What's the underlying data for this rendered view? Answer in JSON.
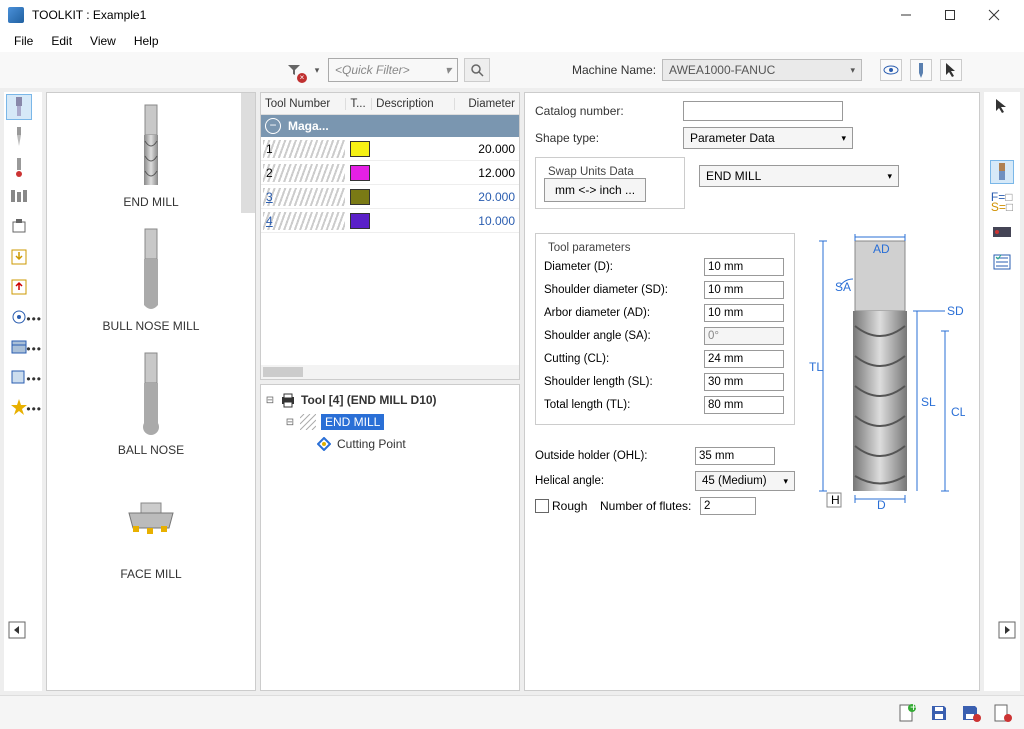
{
  "window": {
    "title": "TOOLKIT : Example1"
  },
  "menu": [
    "File",
    "Edit",
    "View",
    "Help"
  ],
  "toolbar": {
    "quick_filter_placeholder": "<Quick Filter>",
    "machine_name_label": "Machine Name:",
    "machine_name_value": "AWEA1000-FANUC"
  },
  "tool_types": [
    {
      "name": "END MILL"
    },
    {
      "name": "BULL NOSE MILL"
    },
    {
      "name": "BALL NOSE"
    },
    {
      "name": "FACE MILL"
    }
  ],
  "table": {
    "cols": [
      "Tool Number",
      "T...",
      "Description",
      "Diameter"
    ],
    "magazine_label": "Maga...",
    "rows": [
      {
        "num": "1",
        "color": "#f6f215",
        "diameter": "20.000",
        "link": false,
        "blue": false
      },
      {
        "num": "2",
        "color": "#e520e5",
        "diameter": "12.000",
        "link": false,
        "blue": false
      },
      {
        "num": "3",
        "color": "#7a7a15",
        "diameter": "20.000",
        "link": true,
        "blue": true
      },
      {
        "num": "4",
        "color": "#5a20c8",
        "diameter": "10.000",
        "link": true,
        "blue": true
      }
    ]
  },
  "tree": {
    "root": "Tool [4] (END MILL D10)",
    "child1": "END MILL",
    "child2": "Cutting Point"
  },
  "props": {
    "catalog_label": "Catalog number:",
    "catalog_value": "",
    "shape_label": "Shape type:",
    "shape_value": "Parameter Data",
    "swap_legend": "Swap Units Data",
    "swap_btn": "mm <-> inch ...",
    "tool_type_value": "END MILL",
    "params_legend": "Tool parameters",
    "params": [
      {
        "label": "Diameter (D):",
        "value": "10 mm"
      },
      {
        "label": "Shoulder diameter (SD):",
        "value": "10 mm"
      },
      {
        "label": "Arbor diameter (AD):",
        "value": "10 mm"
      },
      {
        "label": "Shoulder angle (SA):",
        "value": "0°",
        "ro": true
      },
      {
        "label": "Cutting (CL):",
        "value": "24 mm"
      },
      {
        "label": "Shoulder length (SL):",
        "value": "30 mm"
      },
      {
        "label": "Total length (TL):",
        "value": "80 mm"
      }
    ],
    "ohl_label": "Outside holder (OHL):",
    "ohl_value": "35 mm",
    "ha_label": "Helical angle:",
    "ha_value": "45 (Medium)",
    "rough_label": "Rough",
    "flutes_label": "Number of flutes:",
    "flutes_value": "2"
  },
  "diagram": {
    "AD": "AD",
    "SA": "SA",
    "SD": "SD",
    "TL": "TL",
    "SL": "SL",
    "CL": "CL",
    "D": "D",
    "H": "H"
  }
}
